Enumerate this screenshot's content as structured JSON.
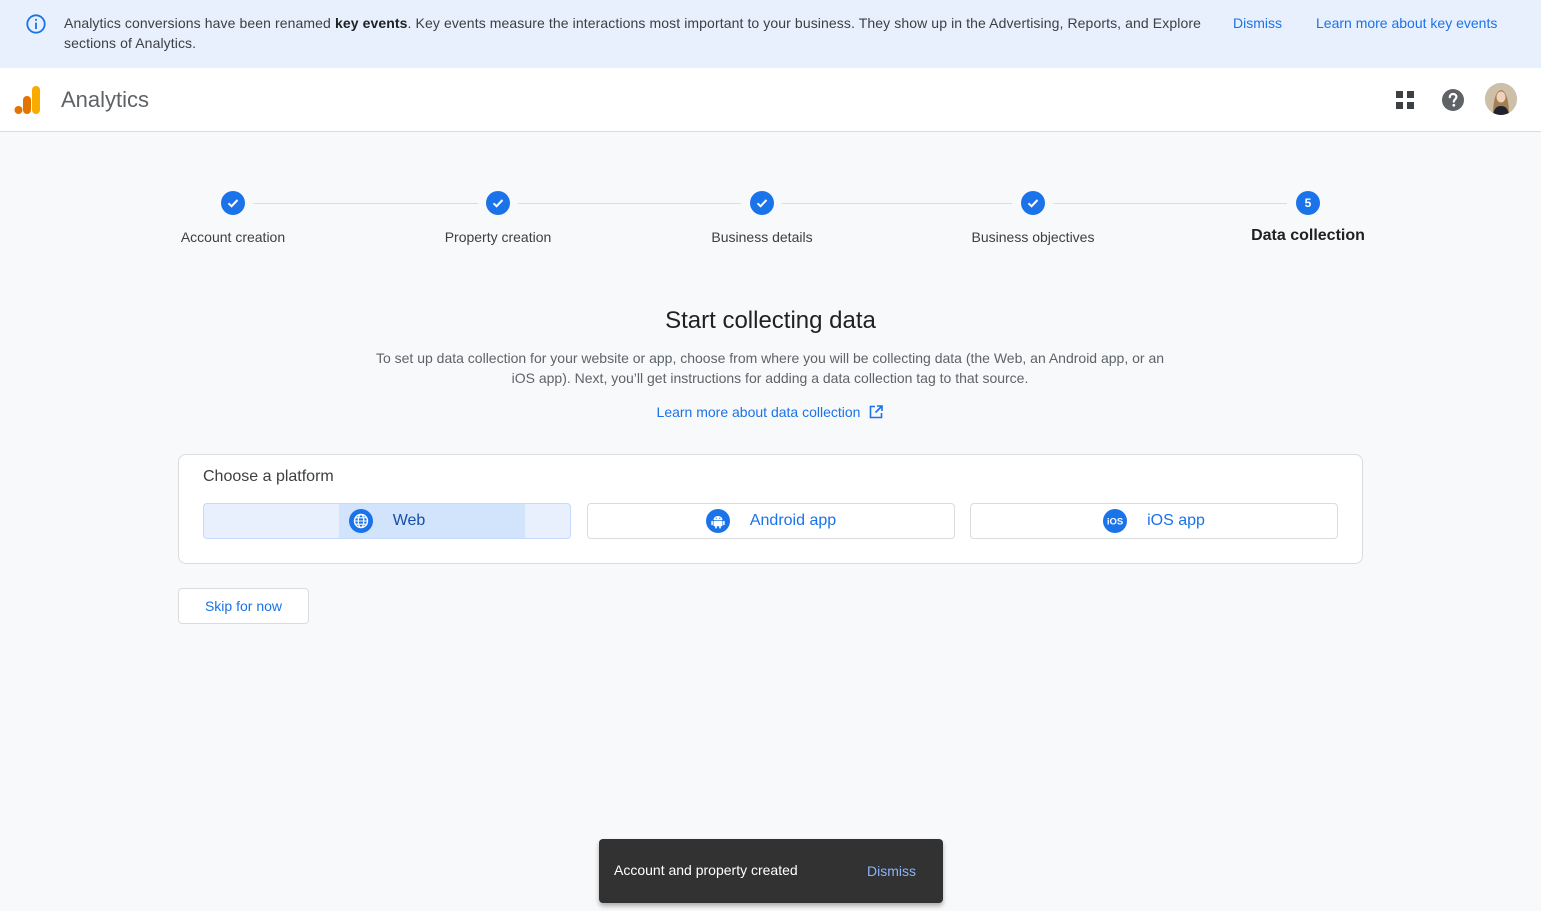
{
  "banner": {
    "text_before": "Analytics conversions have been renamed ",
    "text_bold": "key events",
    "text_after": ". Key events measure the interactions most important to your business. They show up in the Advertising, Reports, and Explore sections of Analytics.",
    "dismiss_label": "Dismiss",
    "learn_label": "Learn more about key events",
    "icon": "info-icon"
  },
  "header": {
    "title": "Analytics",
    "icons": [
      "analytics-logo-icon",
      "apps-grid-icon",
      "help-icon",
      "avatar"
    ]
  },
  "stepper": {
    "steps": [
      {
        "label": "Account creation",
        "status": "complete"
      },
      {
        "label": "Property creation",
        "status": "complete"
      },
      {
        "label": "Business details",
        "status": "complete"
      },
      {
        "label": "Business objectives",
        "status": "complete"
      },
      {
        "label": "Data collection",
        "status": "active",
        "number": "5"
      }
    ]
  },
  "main": {
    "title": "Start collecting data",
    "description": "To set up data collection for your website or app, choose from where you will be collecting data (the Web, an Android app, or an iOS app). Next, you’ll get instructions for adding a data collection tag to that source.",
    "learn_label": "Learn more about data collection"
  },
  "platform": {
    "title": "Choose a platform",
    "options": [
      {
        "label": "Web",
        "icon": "globe-icon",
        "selected": true
      },
      {
        "label": "Android app",
        "icon": "android-icon",
        "selected": false
      },
      {
        "label": "iOS app",
        "icon": "ios-icon",
        "selected": false
      }
    ]
  },
  "skip_label": "Skip for now",
  "snackbar": {
    "message": "Account and property created",
    "dismiss_label": "Dismiss"
  },
  "colors": {
    "accent": "#1a73e8",
    "banner_bg": "#e8f0fe",
    "selected_bg": "#e8f0fe",
    "snackbar_bg": "#323232",
    "logo_orange": "#f9ab00",
    "logo_dark_orange": "#e37400"
  }
}
